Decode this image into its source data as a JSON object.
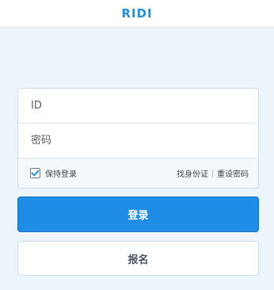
{
  "header": {
    "logo_text": "RIDI",
    "logo_color": "#1e8ee3"
  },
  "form": {
    "id_placeholder": "ID",
    "password_placeholder": "密码",
    "keep_login_label": "保持登录",
    "keep_login_checked": true,
    "find_id_label": "找身份证",
    "reset_password_label": "重设密码"
  },
  "buttons": {
    "login_label": "登录",
    "signup_label": "报名"
  },
  "colors": {
    "accent": "#1f8ce6",
    "background": "#edf4fa"
  }
}
